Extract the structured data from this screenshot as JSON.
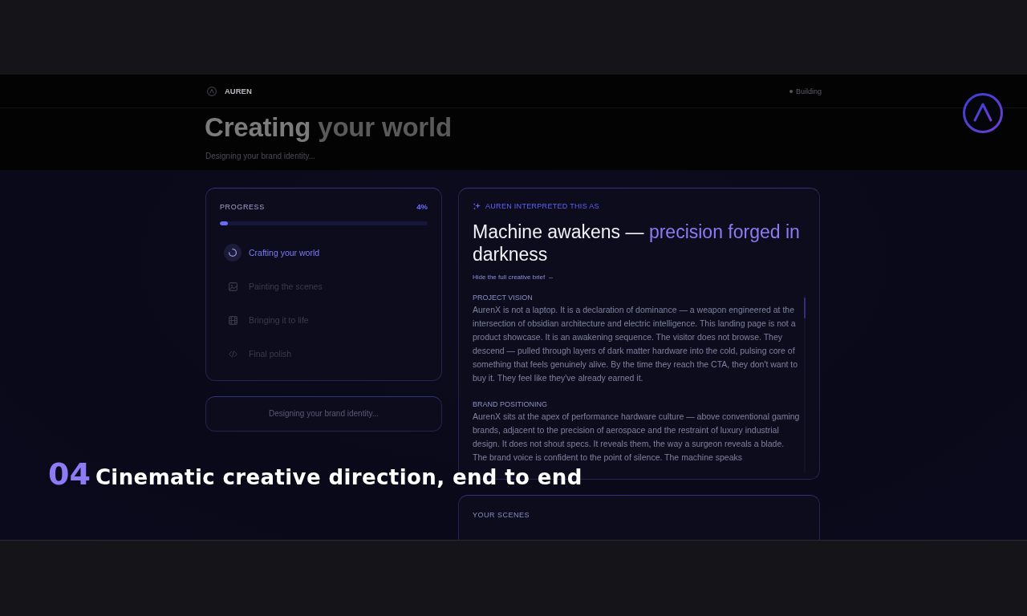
{
  "nav": {
    "brand": "AUREN",
    "status": "Building"
  },
  "page": {
    "title_lead": "Creating",
    "title_rest": "your world",
    "subtitle": "Designing your brand identity..."
  },
  "progress": {
    "label": "PROGRESS",
    "percent": "4%",
    "level": 0.04,
    "steps": [
      {
        "label": "Crafting your world",
        "active": true
      },
      {
        "label": "Painting the scenes",
        "active": false
      },
      {
        "label": "Bringing it to life",
        "active": false
      },
      {
        "label": "Final polish",
        "active": false
      }
    ]
  },
  "status_card": {
    "text": "Designing your brand identity..."
  },
  "interpretation": {
    "eyebrow": "AUREN INTERPRETED THIS AS",
    "headline": [
      {
        "text": "Machine awakens —",
        "accent": false
      },
      {
        "text": "precision forged in",
        "accent": true
      },
      {
        "text": "darkness",
        "accent": false
      }
    ],
    "toggle": "Hide the full creative brief",
    "sections": [
      {
        "heading": "PROJECT VISION",
        "body": "AurenX is not a laptop. It is a declaration of dominance — a weapon engineered at the intersection of obsidian architecture and electric intelligence. This landing page is not a product showcase. It is an awakening sequence. The visitor does not browse. They descend — pulled through layers of dark matter hardware into the cold, pulsing core of something that feels genuinely alive. By the time they reach the CTA, they don't want to buy it. They feel like they've already earned it."
      },
      {
        "heading": "BRAND POSITIONING",
        "body": "AurenX sits at the apex of performance hardware culture — above conventional gaming brands, adjacent to the precision of aerospace and the restraint of luxury industrial design. It does not shout specs. It reveals them, the way a surgeon reveals a blade. The brand voice is confident to the point of silence. The machine speaks"
      }
    ]
  },
  "scenes": {
    "title": "YOUR SCENES"
  },
  "caption": {
    "number": "04",
    "text": "Cinematic creative direction, end to end"
  }
}
